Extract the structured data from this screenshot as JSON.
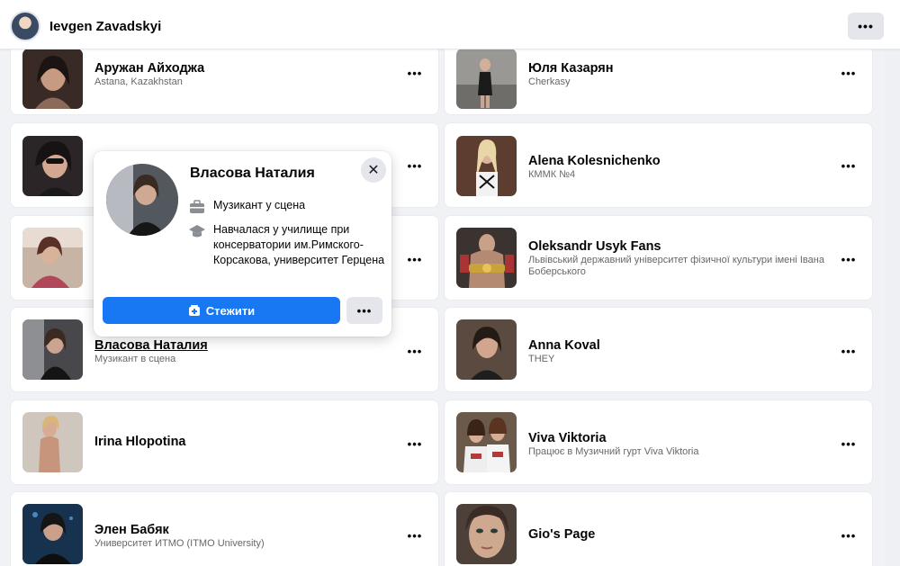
{
  "header": {
    "user_name": "Ievgen Zavadskyi",
    "more_label": "•••"
  },
  "more_label": "•••",
  "left_cards": [
    {
      "name": "Аружан Айходжа",
      "sub": "Astana, Kazakhstan",
      "photo_color": "#5a3c30"
    },
    {
      "name": "",
      "sub": "",
      "photo_color": "#2a2426"
    },
    {
      "name": "",
      "sub": "",
      "photo_color": "#b58a74"
    },
    {
      "name": "Власова Наталия",
      "sub": "Музикант в сцена",
      "photo_color": "#3f3f44"
    },
    {
      "name": "Irina Hlopotina",
      "sub": "",
      "photo_color": "#c9a78e"
    },
    {
      "name": "Элен Бабяк",
      "sub": "Университет ИТМО (ITMO University)",
      "photo_color": "#1f3e5c"
    }
  ],
  "right_cards": [
    {
      "name": "Юля Казарян",
      "sub": "Cherkasy",
      "photo_color": "#8c8a86"
    },
    {
      "name": "Alena Kolesnichenko",
      "sub": "КММК №4",
      "photo_color": "#4b3328"
    },
    {
      "name": "Oleksandr Usyk Fans",
      "sub": "Львівський державний університет фізичної культури імені Івана Боберського",
      "photo_color": "#3a3230"
    },
    {
      "name": "Anna Koval",
      "sub": "THEY",
      "photo_color": "#4a3a32"
    },
    {
      "name": "Viva Viktoria",
      "sub": "Працює в Музичний гурт Viva Viktoria",
      "photo_color": "#7a5a48"
    },
    {
      "name": "Gio's Page",
      "sub": "",
      "photo_color": "#7a6c60"
    }
  ],
  "hovercard": {
    "name": "Власова Наталия",
    "work": "Музикант у сцена",
    "education": "Навчалася у училище при консерватории им.Римского-Корсакова, университет Герцена",
    "follow_label": "Стежити",
    "more_label": "•••",
    "close_label": "✕"
  },
  "colors": {
    "accent": "#1877f2",
    "background": "#f0f2f5",
    "secondary_text": "#65676b"
  }
}
